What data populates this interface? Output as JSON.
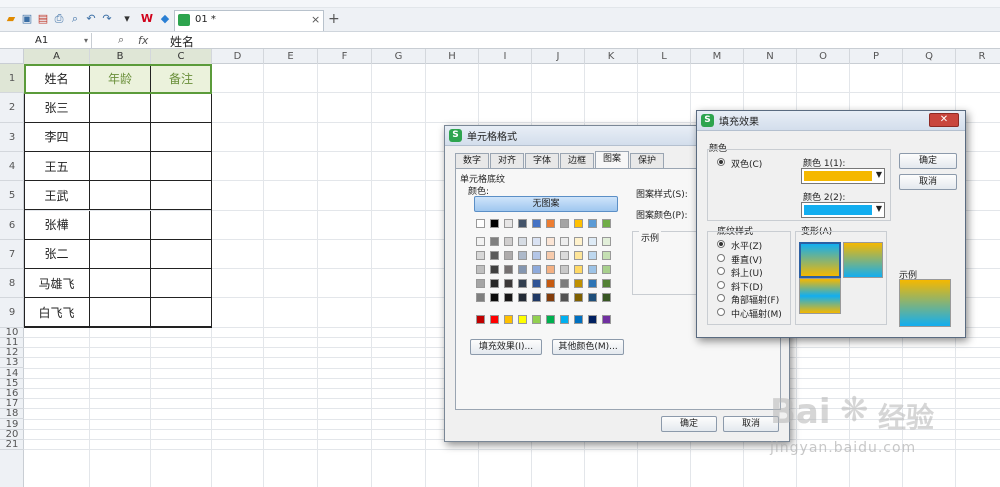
{
  "toolbar": {
    "doc_tab": "01 *",
    "add_tab": "+",
    "close_tab": "×"
  },
  "formula": {
    "cell_ref": "A1",
    "fx": "fx",
    "value": "姓名"
  },
  "columns": [
    "A",
    "B",
    "C",
    "D",
    "E",
    "F",
    "G",
    "H",
    "I",
    "J",
    "K",
    "L",
    "M",
    "N",
    "O",
    "P",
    "Q",
    "R"
  ],
  "rows": [
    "1",
    "2",
    "3",
    "4",
    "5",
    "6",
    "7",
    "8",
    "9",
    "10",
    "11",
    "12",
    "13",
    "14",
    "15",
    "16",
    "17",
    "18",
    "19",
    "20",
    "21"
  ],
  "table": {
    "headers": [
      "姓名",
      "年龄",
      "备注"
    ],
    "names": [
      "张三",
      "李四",
      "王五",
      "王武",
      "张樺",
      "张二",
      "马雄飞",
      "白飞飞"
    ]
  },
  "format_dialog": {
    "title": "单元格格式",
    "tabs": [
      "数字",
      "对齐",
      "字体",
      "边框",
      "图案",
      "保护"
    ],
    "group": "单元格底纹",
    "color_label": "颜色:",
    "no_pattern": "无图案",
    "pattern_style": "图案样式(S):",
    "pattern_color": "图案颜色(P):",
    "sample": "示例",
    "fill_effects_btn": "填充效果(I)...",
    "more_colors_btn": "其他颜色(M)...",
    "ok": "确定",
    "cancel": "取消"
  },
  "fill_dialog": {
    "title": "填充效果",
    "colors_group": "颜色",
    "two_color": "双色(C)",
    "color1": "颜色 1(1):",
    "color2": "颜色 2(2):",
    "shading_group": "底纹样式",
    "shading": [
      "水平(Z)",
      "垂直(V)",
      "斜上(U)",
      "斜下(D)",
      "角部辐射(F)",
      "中心辐射(M)"
    ],
    "variants": "变形(A)",
    "sample": "示例",
    "ok": "确定",
    "cancel": "取消",
    "color1_hex": "#f5b800",
    "color2_hex": "#12aef0"
  },
  "watermark": {
    "brand": "Bai",
    "brand2": "经验",
    "url": "jingyan.baidu.com"
  }
}
